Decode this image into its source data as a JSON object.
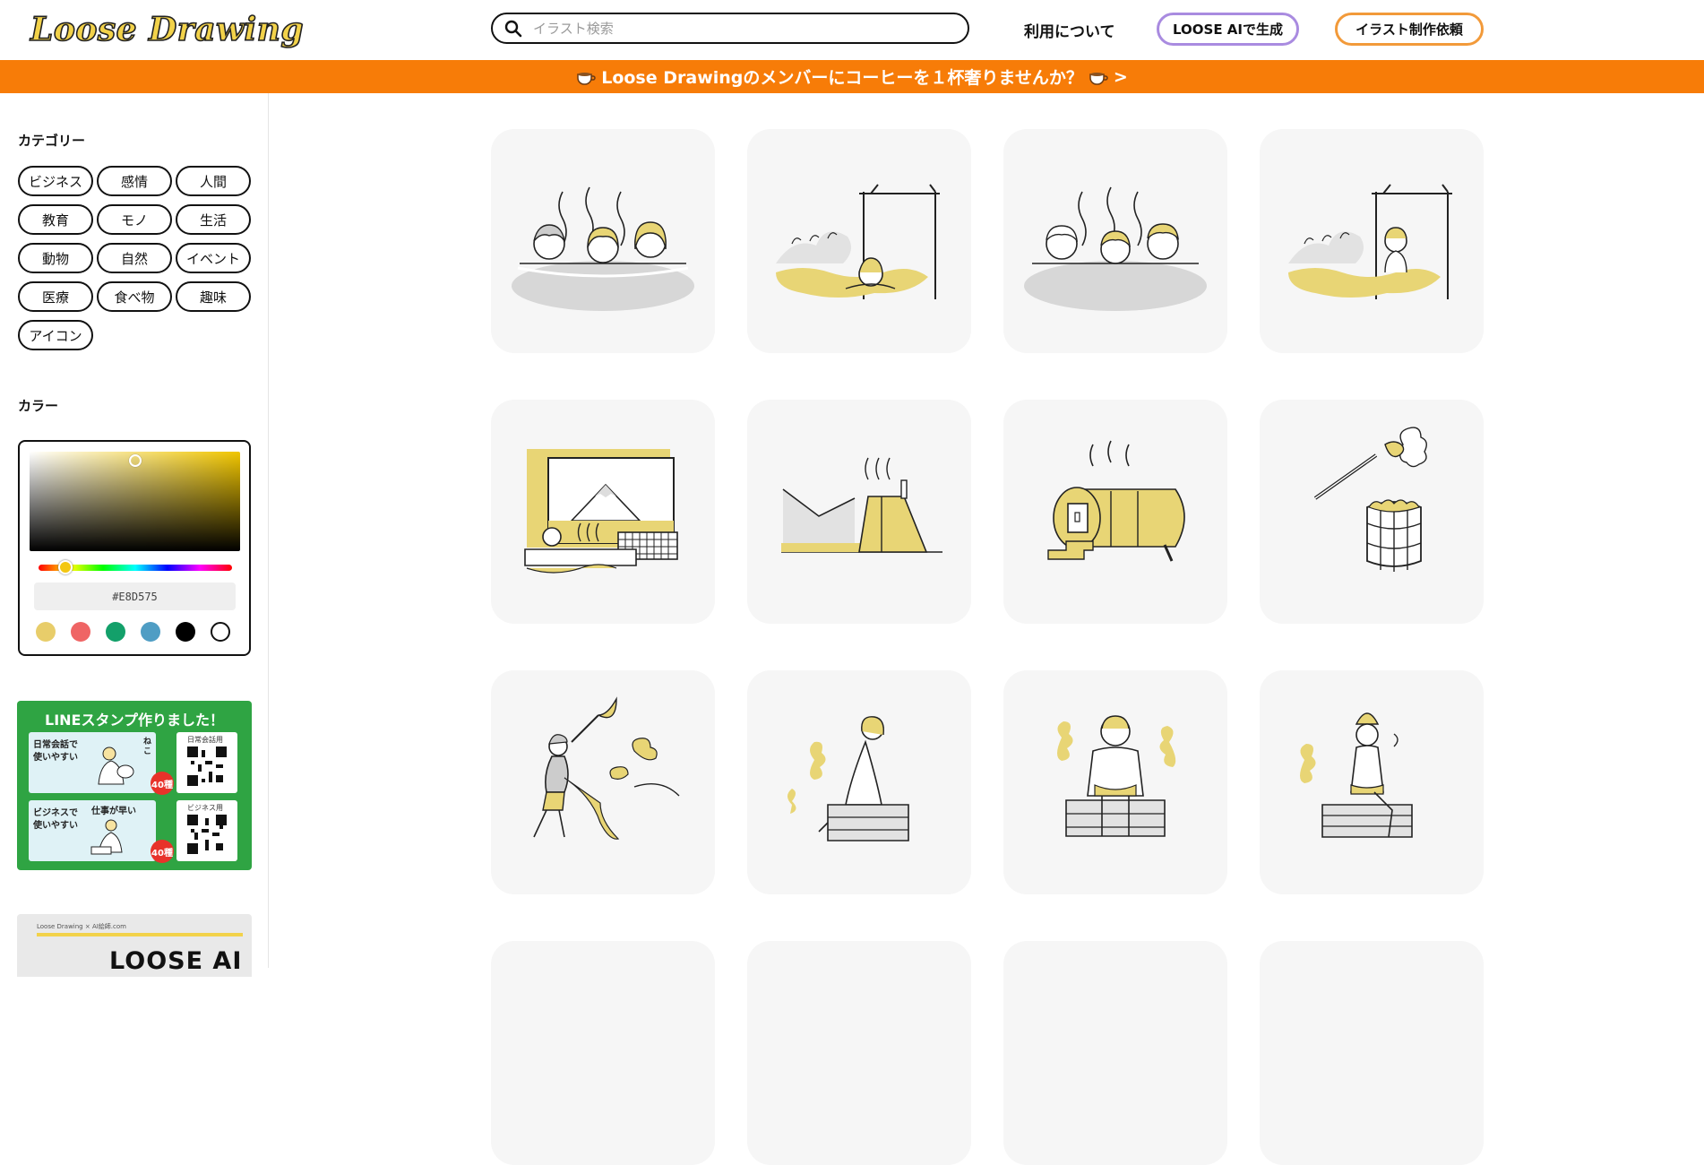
{
  "header": {
    "logo_text": "Loose Drawing",
    "search_placeholder": "イラスト検索",
    "about_label": "利用について",
    "ai_button_label": "LOOSE AIで生成",
    "request_button_label": "イラスト制作依頼"
  },
  "banner": {
    "text": "Loose Drawingのメンバーにコーヒーを１杯奢りませんか？",
    "arrow": ">"
  },
  "sidebar": {
    "category_title": "カテゴリー",
    "categories": [
      "ビジネス",
      "感情",
      "人間",
      "教育",
      "モノ",
      "生活",
      "動物",
      "自然",
      "イベント",
      "医療",
      "食べ物",
      "趣味",
      "アイコン"
    ],
    "color_title": "カラー",
    "color_picker": {
      "hex": "#E8D575",
      "hue_fraction": 0.14,
      "saturation_fraction": 0.5,
      "value_fraction": 0.91,
      "swatches": [
        "#e8cd6a",
        "#ef6565",
        "#13a06a",
        "#4f9dc4",
        "#000000",
        "#ffffff"
      ]
    },
    "line_promo": {
      "title": "LINEスタンプ作りました！",
      "card1_text": "日常会話で使いやすい",
      "card1_side": "ねこ",
      "card1_qr_label": "日常会話用",
      "card2_text": "ビジネスで使いやすい",
      "card2_side": "仕事が早い",
      "card2_qr_label": "ビジネス用",
      "badge": "40種"
    },
    "ai_promo": {
      "small_text": "Loose Drawing × AI絵師.com",
      "title": "LOOSE AI"
    }
  },
  "colors": {
    "accent_orange": "#f77c08",
    "accent_yellow": "#e8d575",
    "ai_border": "#a98be0",
    "request_border": "#f29a3a"
  },
  "gallery": {
    "tiles": [
      "women-in-onsen",
      "woman-outdoor-bath",
      "men-in-onsen",
      "man-outdoor-bath",
      "bathhouse-mount-fuji",
      "sauna-building",
      "barrel-sauna",
      "sauna-stones-ladle",
      "person-whisking-steam",
      "woman-sweating-sauna",
      "man-sitting-sauna",
      "person-sauna-hat"
    ]
  }
}
